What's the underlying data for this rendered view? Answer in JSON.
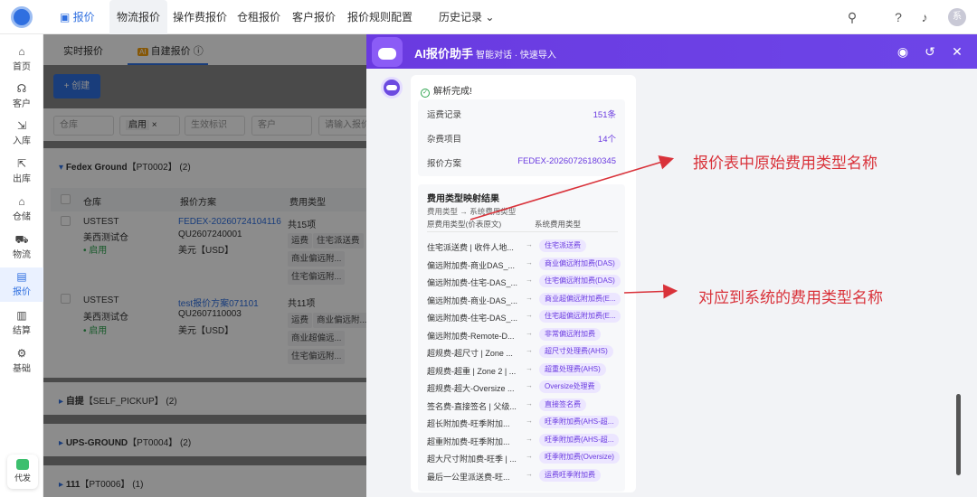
{
  "topbar": {
    "tabs": [
      {
        "label": "报价",
        "icon": "document-icon"
      },
      {
        "label": "物流报价"
      },
      {
        "label": "操作费报价"
      },
      {
        "label": "仓租报价"
      },
      {
        "label": "客户报价"
      },
      {
        "label": "报价规则配置"
      },
      {
        "label": "历史记录"
      }
    ],
    "avatar": "系"
  },
  "sidebar": {
    "items": [
      {
        "label": "首页"
      },
      {
        "label": "客户"
      },
      {
        "label": "入库"
      },
      {
        "label": "出库"
      },
      {
        "label": "仓储"
      },
      {
        "label": "物流"
      },
      {
        "label": "报价"
      },
      {
        "label": "结算"
      },
      {
        "label": "基础"
      }
    ],
    "daifa": "代发"
  },
  "main": {
    "subtabs": {
      "realtime": "实时报价",
      "ai_badge": "AI",
      "custom": "自建报价"
    },
    "create_btn": "+ 创建",
    "filters": {
      "warehouse": "仓库",
      "status": "启用",
      "effective": "生效标识",
      "customer": "客户",
      "input": "请输入报价"
    },
    "group1": {
      "name": "Fedex Ground",
      "code": "【PT0002】",
      "count": "(2)"
    },
    "columns": {
      "warehouse": "仓库",
      "plan": "报价方案",
      "fee_type": "费用类型"
    },
    "rows": [
      {
        "warehouse": "USTEST",
        "warehouse_name": "美西测试仓",
        "status": "• 启用",
        "plan": "FEDEX-20260724104116",
        "plan_code": "QU2607240001",
        "currency": "美元【USD】",
        "total": "共15项",
        "tags": [
          "运费",
          "住宅派送费",
          "商业偏远附...",
          "住宅偏远附..."
        ]
      },
      {
        "warehouse": "USTEST",
        "warehouse_name": "美西测试仓",
        "status": "• 启用",
        "plan": "test报价方案071101",
        "plan_code": "QU2607110003",
        "currency": "美元【USD】",
        "total": "共11项",
        "tags": [
          "运费",
          "商业偏远附...",
          "商业超偏远...",
          "住宅偏远附..."
        ]
      }
    ],
    "groups": [
      {
        "name": "自提",
        "code": "【SELF_PICKUP】",
        "count": "(2)"
      },
      {
        "name": "UPS-GROUND",
        "code": "【PT0004】",
        "count": "(2)"
      },
      {
        "name": "111",
        "code": "【PT0006】",
        "count": "(1)"
      }
    ]
  },
  "panel": {
    "title": "AI报价助手",
    "subtitle": "智能对话 · 快速导入",
    "done": "解析完成!",
    "summary": [
      {
        "label": "运费记录",
        "value": "151条"
      },
      {
        "label": "杂费项目",
        "value": "14个"
      },
      {
        "label": "报价方案",
        "value": "FEDEX-20260726180345"
      }
    ],
    "map_title": "费用类型映射结果",
    "map_sub": "费用类型 → 系统费用类型",
    "map_head_orig": "原费用类型(价表原文)",
    "map_head_sys": "系统费用类型",
    "mappings": [
      {
        "orig": "住宅派送费 | 收件人地...",
        "sys": "住宅派送费"
      },
      {
        "orig": "偏远附加费-商业DAS_...",
        "sys": "商业偏远附加费(DAS)"
      },
      {
        "orig": "偏远附加费-住宅-DAS_...",
        "sys": "住宅偏远附加费(DAS)"
      },
      {
        "orig": "偏远附加费-商业-DAS_...",
        "sys": "商业超偏远附加费(E..."
      },
      {
        "orig": "偏远附加费-住宅-DAS_...",
        "sys": "住宅超偏远附加费(E..."
      },
      {
        "orig": "偏远附加费-Remote-D...",
        "sys": "非常偏远附加费"
      },
      {
        "orig": "超规费-超尺寸 | Zone ...",
        "sys": "超尺寸处理费(AHS)"
      },
      {
        "orig": "超规费-超重 | Zone 2 | ...",
        "sys": "超重处理费(AHS)"
      },
      {
        "orig": "超规费-超大-Oversize ...",
        "sys": "Oversize处理费"
      },
      {
        "orig": "签名费-直接签名 | 父级...",
        "sys": "直接签名费"
      },
      {
        "orig": "超长附加费-旺季附加...",
        "sys": "旺季附加费(AHS-超..."
      },
      {
        "orig": "超重附加费-旺季附加...",
        "sys": "旺季附加费(AHS-超..."
      },
      {
        "orig": "超大尺寸附加费-旺季 | ...",
        "sys": "旺季附加费(Oversize)"
      },
      {
        "orig": "最后一公里派送费-旺...",
        "sys": "运费旺季附加费"
      }
    ]
  },
  "annotations": {
    "top": "报价表中原始费用类型名称",
    "bottom": "对应到系统的费用类型名称",
    "color": "#d9323a"
  },
  "colors": {
    "primary": "#2f6fe0",
    "ai_purple": "#6a3ae0"
  }
}
